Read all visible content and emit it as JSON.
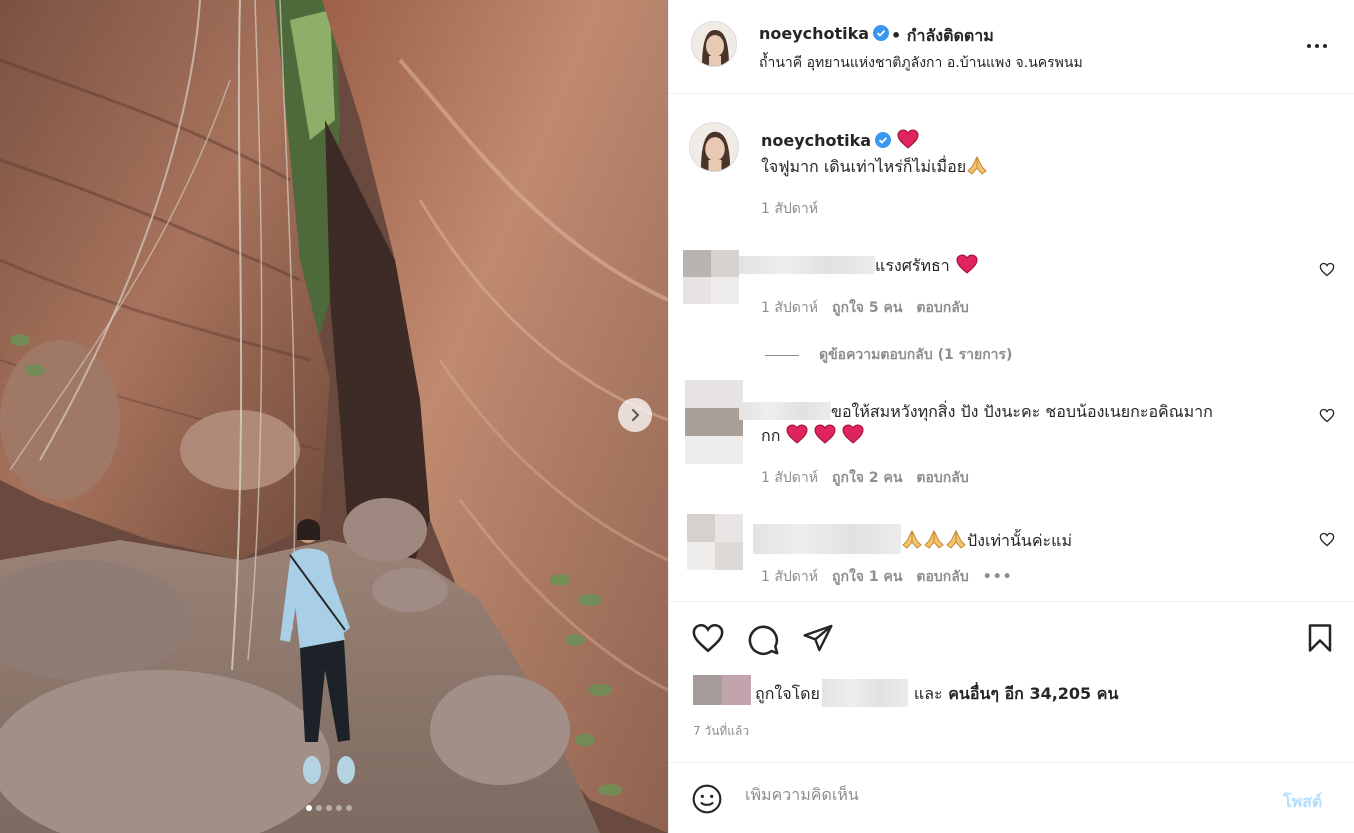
{
  "post": {
    "username": "noeychotika",
    "follow_state": "• กำลังติดตาม",
    "location": "ถ้ำนาคี อุทยานแห่งชาติภูลังกา อ.บ้านแพง จ.นครพนม",
    "carousel": {
      "total_images": 5,
      "current_index": 1
    }
  },
  "caption": {
    "username": "noeychotika",
    "text": "ใจฟูมาก เดินเท่าไหร่ก็ไม่เมื่อย",
    "time": "1 สัปดาห์"
  },
  "comments": [
    {
      "text": "แรงศรัทธา",
      "time": "1 สัปดาห์",
      "likes": "ถูกใจ 5 คน",
      "reply": "ตอบกลับ"
    },
    {
      "text_line1": "ขอให้สมหวังทุกสิ่ง ปัง ปังนะคะ ชอบน้องเนยกะอคิณมาก",
      "text_line2": "กก",
      "time": "1 สัปดาห์",
      "likes": "ถูกใจ 2 คน",
      "reply": "ตอบกลับ"
    },
    {
      "text": "ปังเท่านั้นค่ะแม่",
      "time": "1 สัปดาห์",
      "likes": "ถูกใจ 1 คน",
      "reply": "ตอบกลับ",
      "more": "•••"
    }
  ],
  "view_replies": "ดูข้อความตอบกลับ (1 รายการ)",
  "likes": {
    "prefix": "ถูกใจโดย",
    "and": "และ",
    "others": "คนอื่นๆ อีก 34,205 คน"
  },
  "post_date": "7 วันที่แล้ว",
  "add_comment": {
    "placeholder": "เพิ่มความคิดเห็น",
    "post_label": "โพสต์"
  },
  "colors": {
    "verified": "#3897f0",
    "link_disabled": "#b2dffc",
    "meta": "#8e8e8e",
    "heart": "#e0245e"
  }
}
